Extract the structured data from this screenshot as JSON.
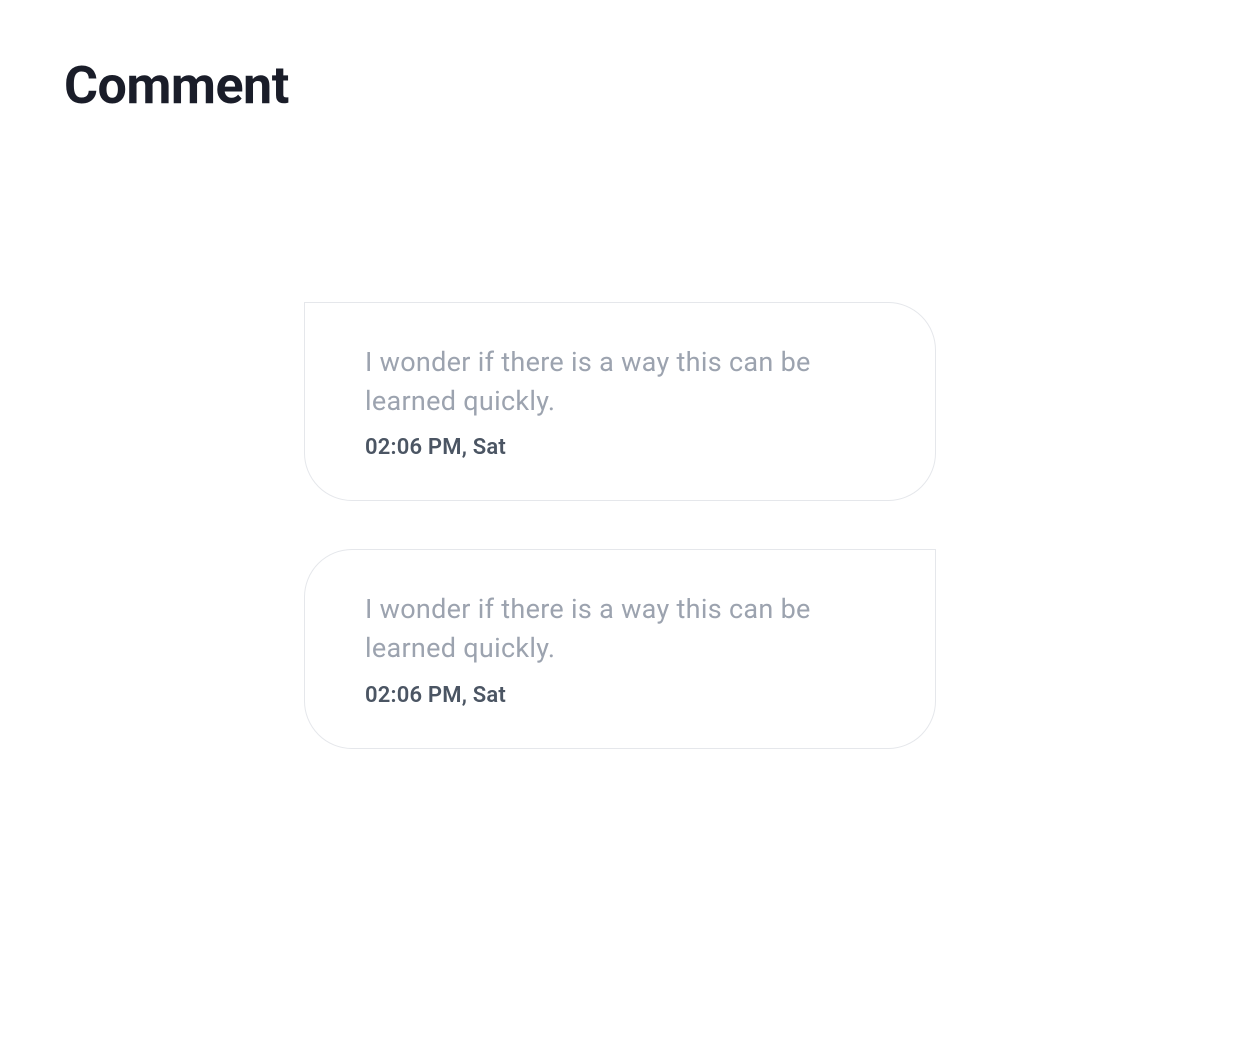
{
  "page": {
    "title": "Comment"
  },
  "comments": [
    {
      "text": "I wonder if there is a way this can be learned quickly.",
      "timestamp": "02:06 PM, Sat"
    },
    {
      "text": "I wonder if there is a way this can be learned quickly.",
      "timestamp": "02:06 PM, Sat"
    }
  ]
}
